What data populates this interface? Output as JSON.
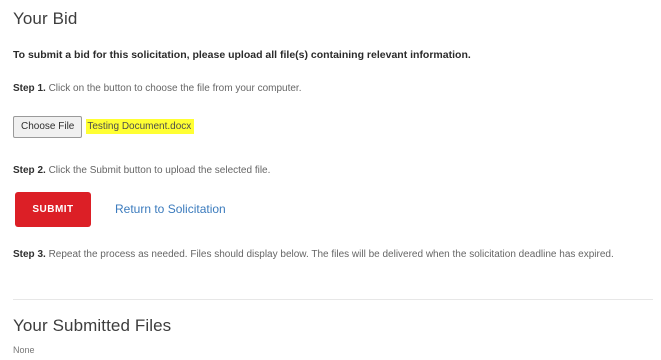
{
  "bid": {
    "title": "Your Bid",
    "instruction": "To submit a bid for this solicitation, please upload all file(s) containing relevant information.",
    "step1": {
      "label": "Step 1.",
      "text": "Click on the button to choose the file from your computer."
    },
    "file_input": {
      "button_label": "Choose File",
      "file_name": "Testing Document.docx"
    },
    "step2": {
      "label": "Step 2.",
      "text": "Click the Submit button to upload the selected file."
    },
    "submit_label": "SUBMIT",
    "return_link": "Return to Solicitation",
    "step3": {
      "label": "Step 3.",
      "text": "Repeat the process as needed. Files should display below. The files will be delivered when the solicitation deadline has expired."
    }
  },
  "submitted": {
    "title": "Your Submitted Files",
    "empty_text": "None"
  },
  "colors": {
    "submit_bg": "#dc1f26",
    "link": "#3b7bbd",
    "highlight": "#ffff33"
  }
}
